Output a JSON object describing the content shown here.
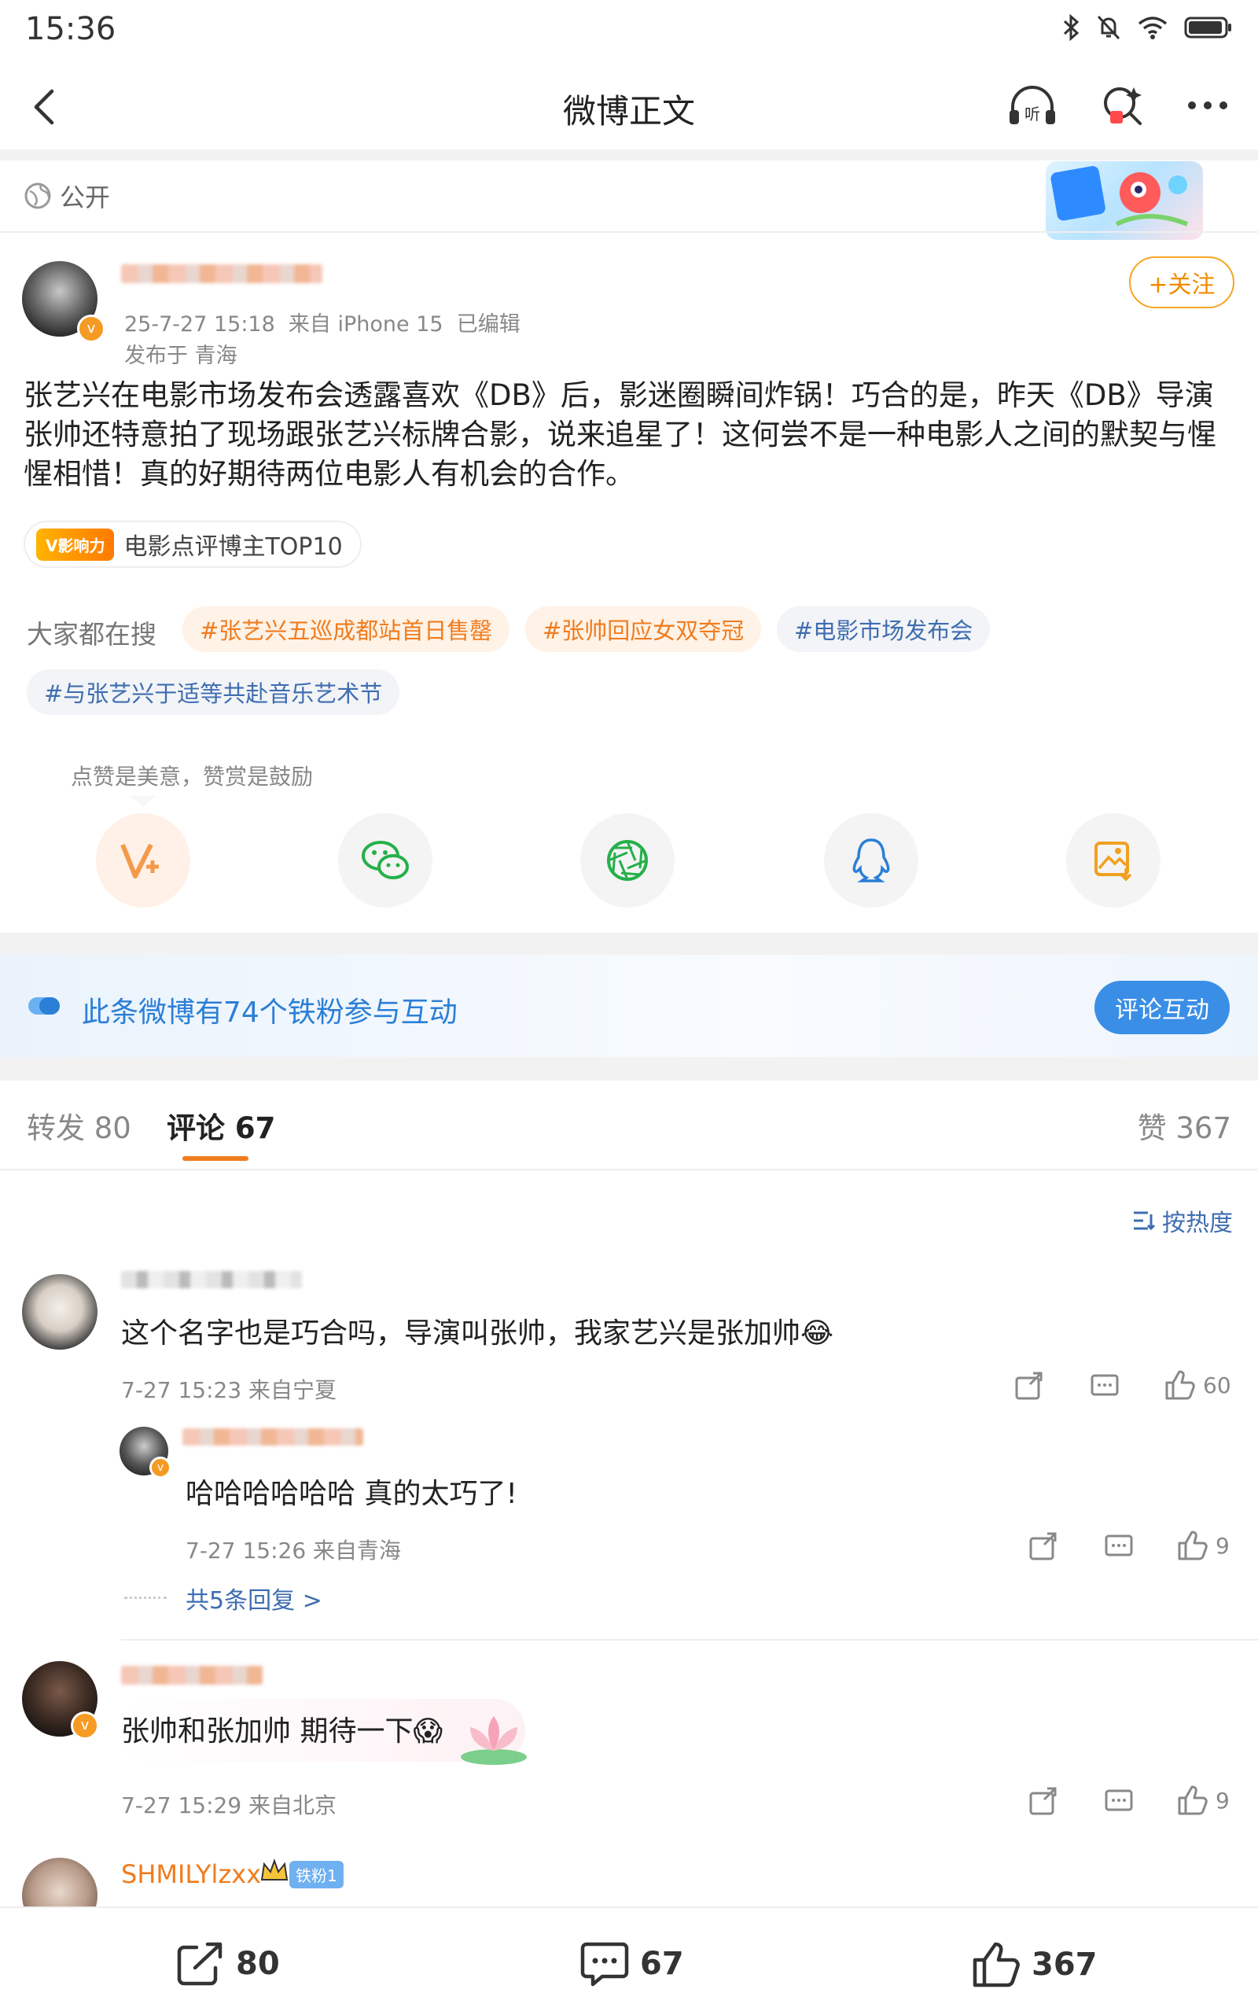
{
  "status_bar": {
    "time": "15:36"
  },
  "header": {
    "title": "微博正文"
  },
  "post": {
    "visibility": "公开",
    "follow_label": "+关注",
    "meta_line": "25-7-27 15:18  来自 iPhone 15  已编辑",
    "location": "发布于 青海",
    "text": "张艺兴在电影市场发布会透露喜欢《DB》后，影迷圈瞬间炸锅！巧合的是，昨天《DB》导演张帅还特意拍了现场跟张艺兴标牌合影，说来追星了！这何尝不是一种电影人之间的默契与惺惺相惜！真的好期待两位电影人有机会的合作。",
    "influence_badge": "V影响力",
    "influence_text": "电影点评博主TOP10",
    "search_label": "大家都在搜",
    "hot_searches": [
      "#张艺兴五巡成都站首日售罄",
      "#张帅回应女双夺冠",
      "#电影市场发布会",
      "#与张艺兴于适等共赴音乐艺术节"
    ],
    "reward_tip": "点赞是美意，赞赏是鼓励"
  },
  "fan_banner": {
    "text": "此条微博有74个铁粉参与互动",
    "button": "评论互动"
  },
  "tabs": {
    "repost": "转发 80",
    "comment": "评论 67",
    "like": "赞 367"
  },
  "sort_label": "按热度",
  "comments": [
    {
      "text": "这个名字也是巧合吗，导演叫张帅，我家艺兴是张加帅😂",
      "meta": "7-27 15:23 来自宁夏",
      "likes": "60",
      "reply": {
        "text": "哈哈哈哈哈哈 真的太巧了!",
        "meta": "7-27 15:26 来自青海",
        "likes": "9"
      },
      "more_replies": "共5条回复 >"
    },
    {
      "text": "张帅和张加帅 期待一下😱",
      "meta": "7-27 15:29 来自北京",
      "likes": "9"
    },
    {
      "username": "SHMILYlzxx",
      "fan_badge": "铁粉1"
    }
  ],
  "bottom_bar": {
    "repost": "80",
    "comment": "67",
    "like": "367"
  },
  "colors": {
    "accent_orange": "#f07c1e",
    "link_blue": "#3f6db0",
    "banner_blue": "#3a8ee6"
  }
}
